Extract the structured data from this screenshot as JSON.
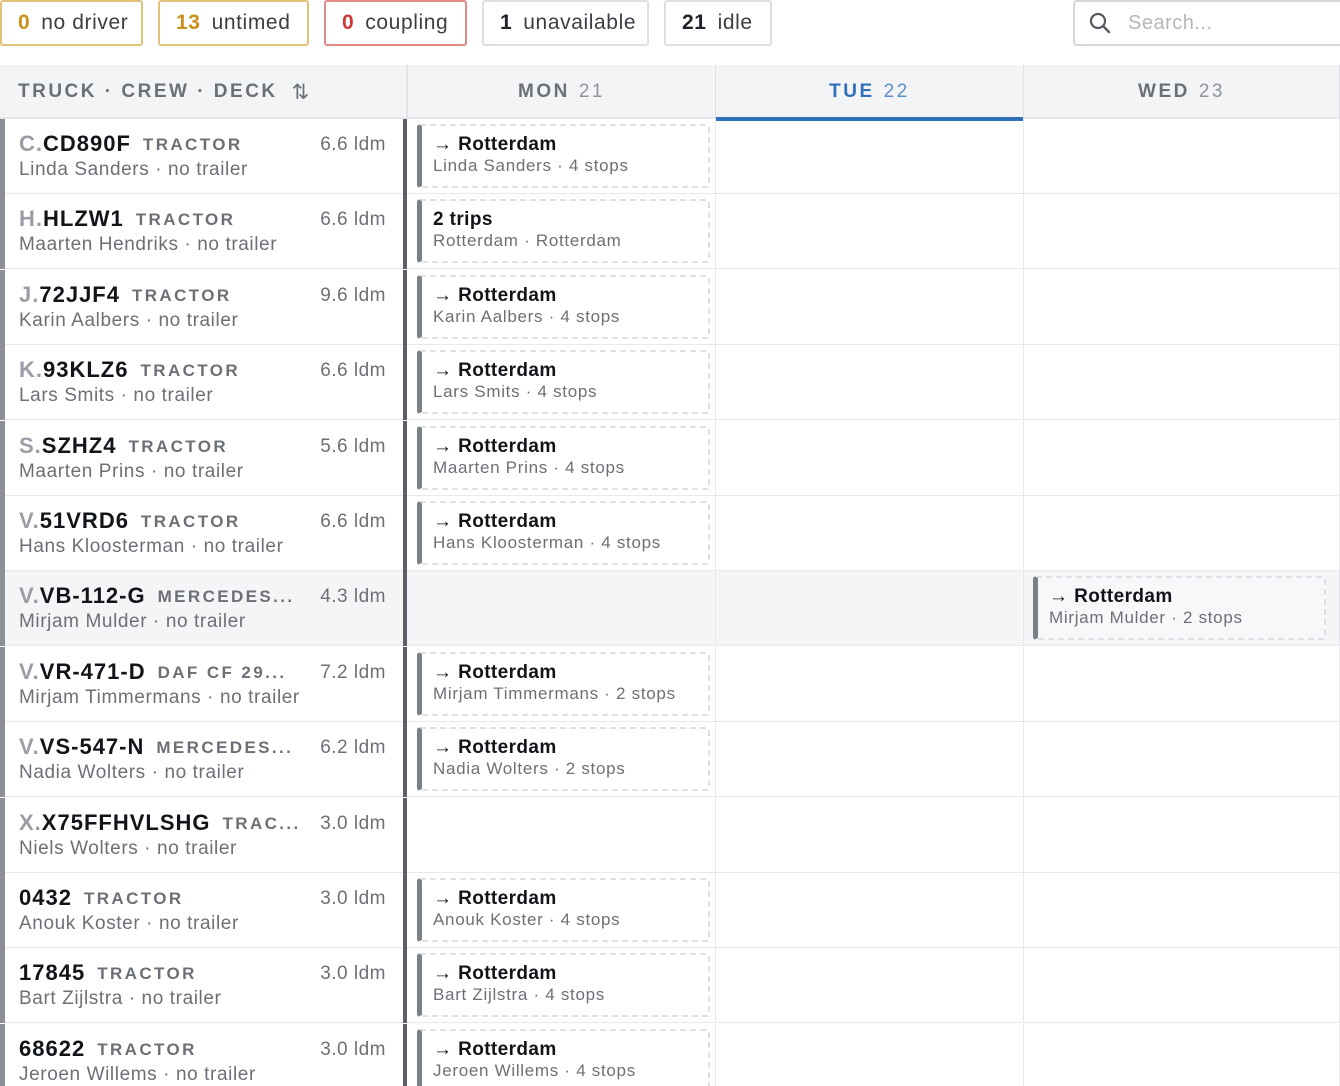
{
  "filters": {
    "no_driver": {
      "count": "0",
      "label": "no driver"
    },
    "untimed": {
      "count": "13",
      "label": "untimed"
    },
    "coupling": {
      "count": "0",
      "label": "coupling"
    },
    "unavailable": {
      "count": "1",
      "label": "unavailable"
    },
    "idle": {
      "count": "21",
      "label": "idle"
    }
  },
  "search": {
    "placeholder": "Search..."
  },
  "header": {
    "first_column": "TRUCK · CREW · DECK",
    "sort_icon": "⇅",
    "days": [
      {
        "dow": "MON",
        "num": "21"
      },
      {
        "dow": "TUE",
        "num": "22"
      },
      {
        "dow": "WED",
        "num": "23"
      }
    ]
  },
  "colors": {
    "accent": "#2f6fb8",
    "warning": "#c8901a",
    "danger": "#d03838"
  },
  "trucks": [
    {
      "prefix": "C.",
      "plate": "CD890F",
      "type": "TRACTOR",
      "ldm": "6.6 ldm",
      "crew": "Linda Sanders · no trailer",
      "trips": [
        {
          "day": 0,
          "title": "→ Rotterdam",
          "sub": "Linda Sanders · 4 stops"
        }
      ]
    },
    {
      "prefix": "H.",
      "plate": "HLZW1",
      "type": "TRACTOR",
      "ldm": "6.6 ldm",
      "crew": "Maarten Hendriks · no trailer",
      "trips": [
        {
          "day": 0,
          "title": "2 trips",
          "sub": "Rotterdam · Rotterdam"
        }
      ]
    },
    {
      "prefix": "J.",
      "plate": "72JJF4",
      "type": "TRACTOR",
      "ldm": "9.6 ldm",
      "crew": "Karin Aalbers · no trailer",
      "trips": [
        {
          "day": 0,
          "title": "→ Rotterdam",
          "sub": "Karin Aalbers · 4 stops"
        }
      ]
    },
    {
      "prefix": "K.",
      "plate": "93KLZ6",
      "type": "TRACTOR",
      "ldm": "6.6 ldm",
      "crew": "Lars Smits · no trailer",
      "trips": [
        {
          "day": 0,
          "title": "→ Rotterdam",
          "sub": "Lars Smits · 4 stops"
        }
      ]
    },
    {
      "prefix": "S.",
      "plate": "SZHZ4",
      "type": "TRACTOR",
      "ldm": "5.6 ldm",
      "crew": "Maarten Prins · no trailer",
      "trips": [
        {
          "day": 0,
          "title": "→ Rotterdam",
          "sub": "Maarten Prins · 4 stops"
        }
      ]
    },
    {
      "prefix": "V.",
      "plate": "51VRD6",
      "type": "TRACTOR",
      "ldm": "6.6 ldm",
      "crew": "Hans Kloosterman · no trailer",
      "trips": [
        {
          "day": 0,
          "title": "→ Rotterdam",
          "sub": "Hans Kloosterman · 4 stops"
        }
      ]
    },
    {
      "prefix": "V.",
      "plate": "VB-112-G",
      "type": "MERCEDES...",
      "ldm": "4.3 ldm",
      "crew": "Mirjam Mulder · no trailer",
      "highlight": true,
      "trips": [
        {
          "day": 2,
          "title": "→ Rotterdam",
          "sub": "Mirjam Mulder · 2 stops"
        }
      ]
    },
    {
      "prefix": "V.",
      "plate": "VR-471-D",
      "type": "DAF CF 29...",
      "ldm": "7.2 ldm",
      "crew": "Mirjam Timmermans · no trailer",
      "trips": [
        {
          "day": 0,
          "title": "→ Rotterdam",
          "sub": "Mirjam Timmermans · 2 stops"
        }
      ]
    },
    {
      "prefix": "V.",
      "plate": "VS-547-N",
      "type": "MERCEDES...",
      "ldm": "6.2 ldm",
      "crew": "Nadia Wolters · no trailer",
      "trips": [
        {
          "day": 0,
          "title": "→ Rotterdam",
          "sub": "Nadia Wolters · 2 stops"
        }
      ]
    },
    {
      "prefix": "X.",
      "plate": "X75FFHVLSHG",
      "type": "TRAC...",
      "ldm": "3.0 ldm",
      "crew": "Niels Wolters · no trailer",
      "trips": []
    },
    {
      "prefix": "",
      "plate": "0432",
      "type": "TRACTOR",
      "ldm": "3.0 ldm",
      "crew": "Anouk Koster · no trailer",
      "trips": [
        {
          "day": 0,
          "title": "→ Rotterdam",
          "sub": "Anouk Koster · 4 stops"
        }
      ]
    },
    {
      "prefix": "",
      "plate": "17845",
      "type": "TRACTOR",
      "ldm": "3.0 ldm",
      "crew": "Bart Zijlstra · no trailer",
      "trips": [
        {
          "day": 0,
          "title": "→ Rotterdam",
          "sub": "Bart Zijlstra · 4 stops"
        }
      ]
    },
    {
      "prefix": "",
      "plate": "68622",
      "type": "TRACTOR",
      "ldm": "3.0 ldm",
      "crew": "Jeroen Willems · no trailer",
      "trips": [
        {
          "day": 0,
          "title": "→ Rotterdam",
          "sub": "Jeroen Willems · 4 stops"
        }
      ]
    }
  ]
}
